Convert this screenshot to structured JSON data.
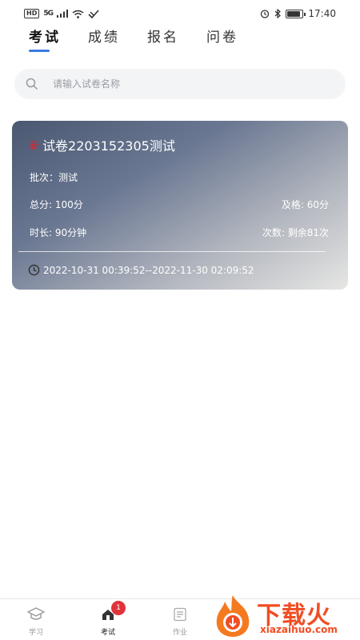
{
  "status_bar": {
    "hd": "HD",
    "signal": "5G",
    "time": "17:40",
    "battery_level": 0.85
  },
  "tabs": [
    {
      "label": "考试",
      "active": true
    },
    {
      "label": "成绩",
      "active": false
    },
    {
      "label": "报名",
      "active": false
    },
    {
      "label": "问卷",
      "active": false
    }
  ],
  "search": {
    "placeholder": "请输入试卷名称",
    "value": ""
  },
  "exam_card": {
    "tag": "新",
    "title": "试卷2203152305测试",
    "batch": "批次：测试",
    "total_score": "总分: 100分",
    "pass_score": "及格: 60分",
    "duration": "时长: 90分钟",
    "attempts": "次数: 剩余81次",
    "time_range": "2022-10-31 00:39:52--2022-11-30 02:09:52"
  },
  "bottom_nav": [
    {
      "label": "学习",
      "icon": "graduation-cap-icon",
      "active": false
    },
    {
      "label": "考试",
      "icon": "exam-icon",
      "active": true,
      "badge": "1"
    },
    {
      "label": "作业",
      "icon": "homework-icon",
      "active": false
    }
  ],
  "watermark": {
    "brand": "下载火",
    "url": "xiazaihuo.com"
  },
  "colors": {
    "accent": "#3a7be0",
    "badge": "#e0343a",
    "watermark": "#f04d23"
  }
}
